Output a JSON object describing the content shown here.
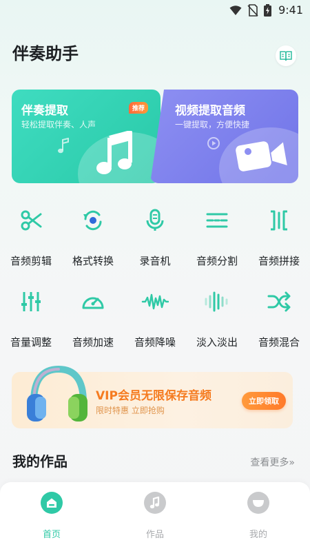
{
  "status_bar": {
    "time": "9:41",
    "icons": [
      "wifi-icon",
      "no-sim-icon",
      "battery-icon"
    ]
  },
  "header": {
    "title": "伴奏助手",
    "manual_icon": "book-icon"
  },
  "cards": [
    {
      "title": "伴奏提取",
      "subtitle": "轻松提取伴奏、人声",
      "badge": "推荐",
      "icon": "music-note-icon",
      "color": "#33d2b4"
    },
    {
      "title": "视频提取音频",
      "subtitle": "一键提取，方便快捷",
      "icon": "video-camera-icon",
      "color": "#7d80ee"
    }
  ],
  "tools": [
    {
      "label": "音频剪辑",
      "icon": "scissors-icon"
    },
    {
      "label": "格式转换",
      "icon": "convert-icon"
    },
    {
      "label": "录音机",
      "icon": "microphone-icon"
    },
    {
      "label": "音频分割",
      "icon": "split-icon"
    },
    {
      "label": "音频拼接",
      "icon": "join-icon"
    },
    {
      "label": "音量调整",
      "icon": "sliders-icon"
    },
    {
      "label": "音频加速",
      "icon": "speedometer-icon"
    },
    {
      "label": "音频降噪",
      "icon": "waveform-icon"
    },
    {
      "label": "淡入淡出",
      "icon": "fade-icon"
    },
    {
      "label": "音频混合",
      "icon": "shuffle-icon"
    }
  ],
  "vip_banner": {
    "title": "VIP会员无限保存音频",
    "subtitle": "限时特惠 立即抢购",
    "button": "立即领取",
    "icon": "headphones-icon"
  },
  "works": {
    "title": "我的作品",
    "more": "查看更多»"
  },
  "tabbar": [
    {
      "label": "首页",
      "icon": "home-icon",
      "active": true
    },
    {
      "label": "作品",
      "icon": "music-note-icon",
      "active": false
    },
    {
      "label": "我的",
      "icon": "profile-icon",
      "active": false
    }
  ],
  "colors": {
    "accent": "#2fc9a6",
    "card_green": "#33d2b4",
    "card_purple": "#7d80ee",
    "vip_orange": "#f57b20",
    "inactive": "#c9cacc"
  }
}
